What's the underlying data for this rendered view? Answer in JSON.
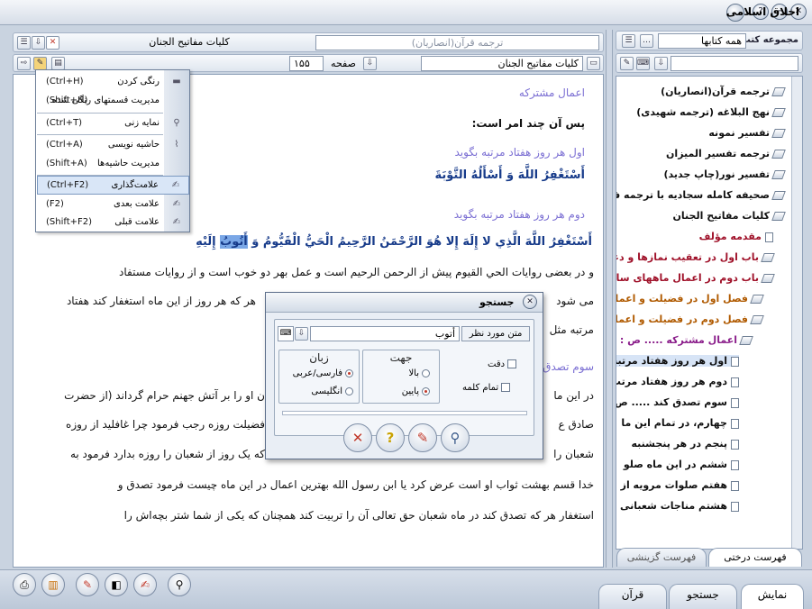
{
  "app": {
    "title": "اخلاق اسلامی"
  },
  "left_panel": {
    "book_title": "کلیات مفاتیح الجنان",
    "translation_tab": "ترجمه قرآن(انصاریان)",
    "book_field": "کلیات مفاتیح الجنان",
    "page_label": "صفحه",
    "page_value": "۱۵۵"
  },
  "context_menu": {
    "items": [
      {
        "label": "رنگی کردن",
        "shortcut": "(Ctrl+H)"
      },
      {
        "label": "مدیریت قسمتهای رنگی شده",
        "shortcut": "(Shift+H)"
      },
      {
        "label": "نمایه زنی",
        "shortcut": "(Ctrl+T)"
      },
      {
        "label": "حاشیه نویسی",
        "shortcut": "(Ctrl+A)"
      },
      {
        "label": "مدیریت حاشیه‌ها",
        "shortcut": "(Shift+A)"
      },
      {
        "label": "علامت‌گذاری",
        "shortcut": "(Ctrl+F2)"
      },
      {
        "label": "علامت بعدی",
        "shortcut": "(F2)"
      },
      {
        "label": "علامت قبلی",
        "shortcut": "(Shift+F2)"
      }
    ]
  },
  "content": {
    "heading": "اعمال مشترکه",
    "intro": "پس آن چند امر است:",
    "item1": "اول هر روز هفتاد مرتبه بگوید",
    "arabic1": "أَسْتَغْفِرُ اللَّهَ وَ أَسْأَلُهُ التَّوْبَةَ",
    "item2": "دوم هر روز هفتاد مرتبه بگوید",
    "arabic2": "أَسْتَغْفِرُ اللَّهَ الَّذِي لا إِلَهَ إِلا هُوَ الرَّحْمَنُ الرَّحِيمُ الْحَيُّ الْقَيُّومُ وَ",
    "arabic2_highlight": "أَتُوبُ",
    "arabic2_end": "إِلَيْهِ",
    "p1": "و در بعضی روایات الحي القیوم پیش از الرحمن الرحیم است و عمل بهر دو خوب است و از روایات مستفاد",
    "p2a": "می شود",
    "p2b": "هر که هر روز از این ماه استغفار کند هفتاد",
    "p3": "مرتبه مثل",
    "p4": "سوم تصدق",
    "p5a": "در این ما",
    "p5b": "ن او را بر آتش جهنم حرام گرداند (از حضرت",
    "p6a": "صادق ع",
    "p6b": "فضیلت روزه رجب فرمود چرا غافلید از روزه",
    "p7a": "شعبان را",
    "p7b": "که یک روز از شعبان را روزه بدارد فرمود به",
    "p8": "خدا قسم بهشت ثواب او است عرض کرد یا ابن رسول الله بهترین اعمال در این ماه چیست فرمود تصدق و",
    "p9": "استغفار هر که تصدق کند در ماه شعبان حق تعالی آن را تربیت کند همچنان که یکی از شما شتر بچه‌اش را"
  },
  "search_dialog": {
    "title": "جستجو",
    "text_label": "متن مورد نظر",
    "text_value": "أتوب",
    "direction_title": "جهت",
    "dir_up": "بالا",
    "dir_down": "پایین",
    "lang_title": "زبان",
    "lang_fa": "فارسی/عربی",
    "lang_en": "انگلیسی",
    "exact_label": "دقت",
    "whole_word_label": "تمام کلمه"
  },
  "right_panel": {
    "title": "مجموعه کتب",
    "filter_value": "همه کتابها",
    "tree": [
      "ترجمه قرآن(انصاریان)",
      "نهج البلاغه (ترجمه شهیدی)",
      "تفسیر نمونه",
      "ترجمه تفسیر المیزان",
      "تفسیر نور(چاپ جدید)",
      "صحیفه کامله سجادیه با ترجمه فارس",
      "کلیات مفاتیح الجنان",
      "مقدمه مؤلف",
      "باب اول در تعقیب نمازها و دعاهای",
      "باب دوم در اعمال ماههای سال و ف",
      "فصل اول در فضیلت و اعمال",
      "فصل دوم در فضیلت و اعمال",
      "اعمال مشترکه ..... ص : د",
      "اول هر روز هفتاد مرتبه",
      "دوم هر روز هفتاد مرتب",
      "سوم تصدق کند ..... ص",
      "چهارم، در تمام این ما",
      "پنجم در هر پنجشنبه",
      "ششم در این ماه صلو",
      "هفتم صلوات مرویه از",
      "هشتم مناجات شعبانی"
    ],
    "tab_tree": "فهرست درختی",
    "tab_list": "فهرست گزینشی"
  },
  "bottom_tabs": [
    "نمایش",
    "جستجو",
    "قرآن"
  ]
}
